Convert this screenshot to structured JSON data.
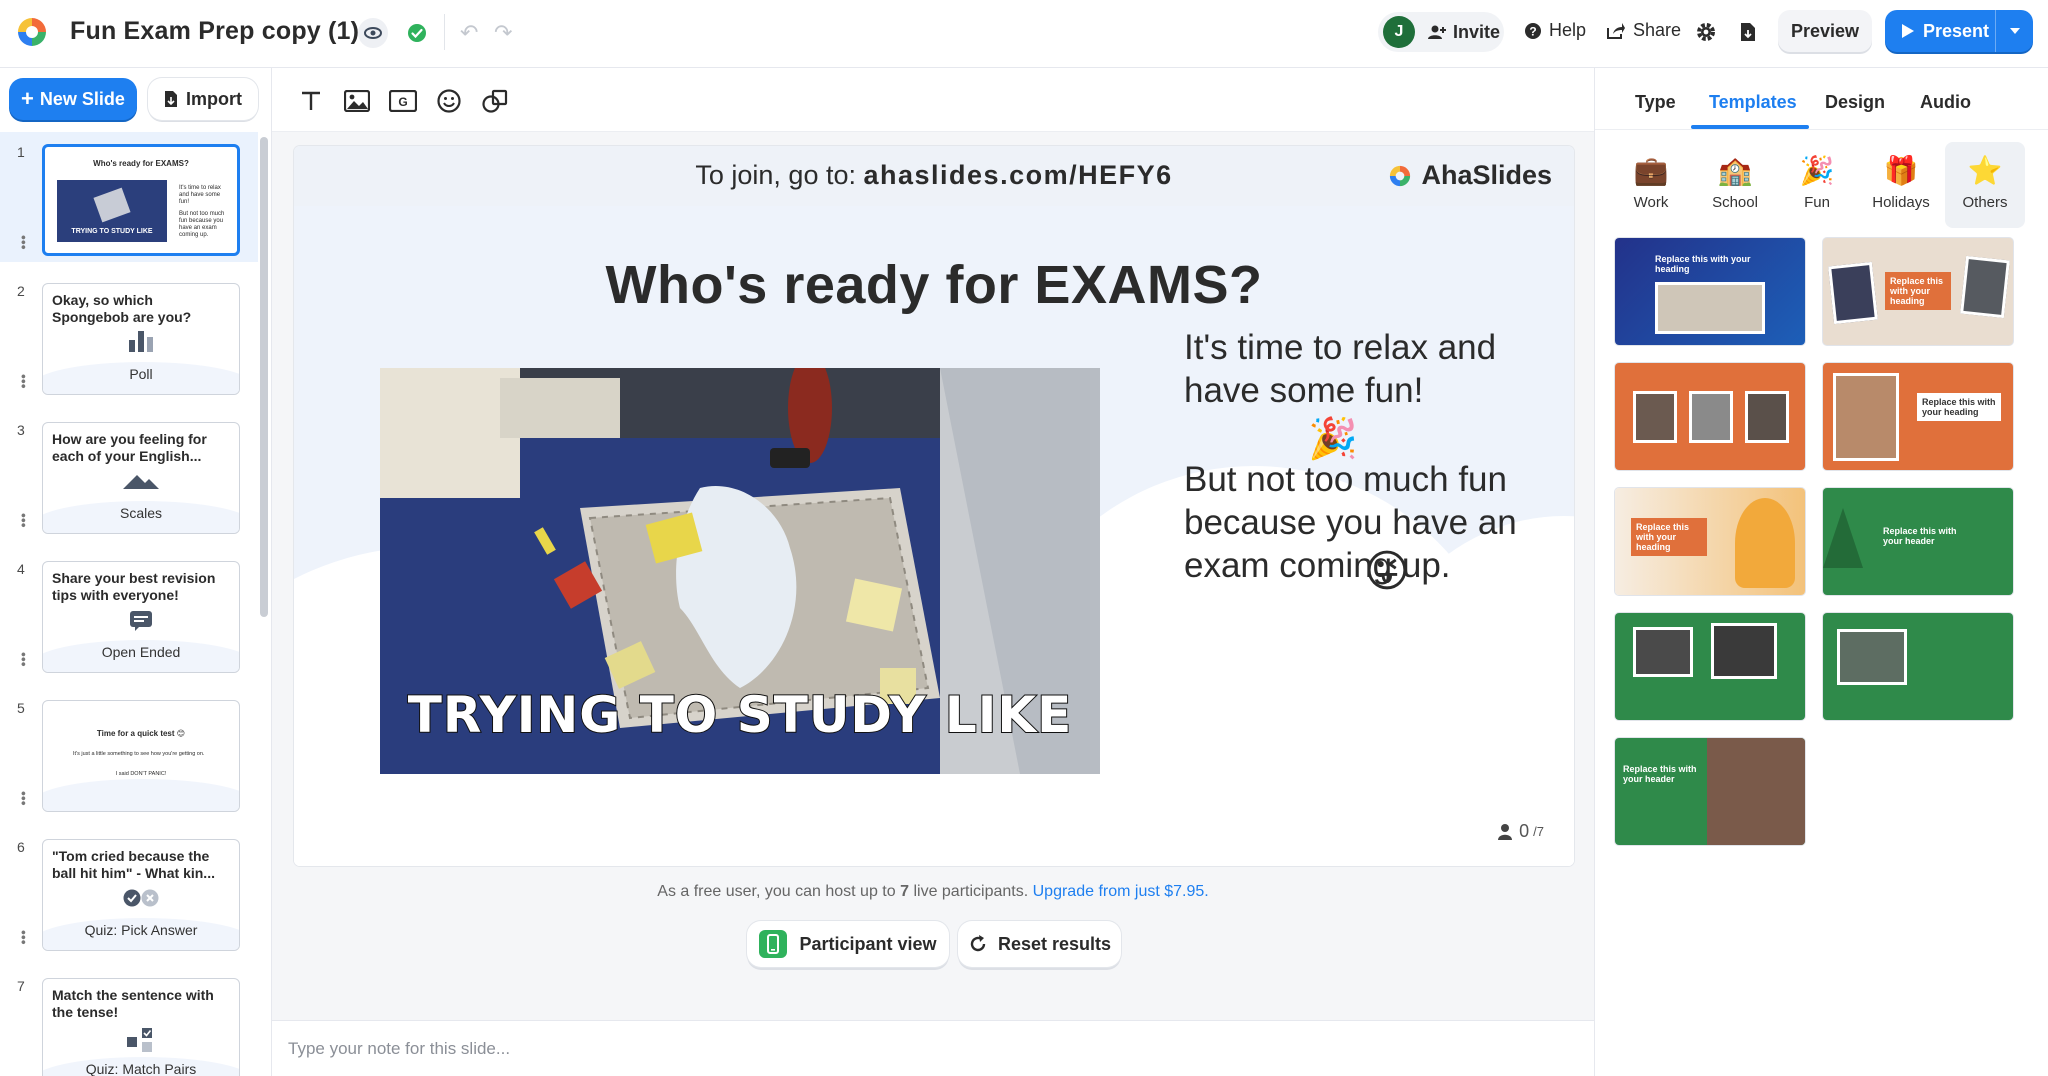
{
  "app": {
    "title": "Fun Exam Prep copy (1)"
  },
  "topbar": {
    "avatar_initial": "J",
    "invite_label": "Invite",
    "help_label": "Help",
    "share_label": "Share",
    "preview_label": "Preview",
    "present_label": "Present"
  },
  "left_panel": {
    "new_slide_label": "New Slide",
    "import_label": "Import"
  },
  "slides": [
    {
      "number": "1",
      "title": "Who's ready for EXAMS?",
      "type": ""
    },
    {
      "number": "2",
      "title": "Okay, so which Spongebob are you?",
      "type": "Poll"
    },
    {
      "number": "3",
      "title": "How are you feeling for each of your English...",
      "type": "Scales"
    },
    {
      "number": "4",
      "title": "Share your best revision tips with everyone!",
      "type": "Open Ended"
    },
    {
      "number": "5",
      "title": "Time for a quick test",
      "type": ""
    },
    {
      "number": "6",
      "title": "\"Tom cried because the ball hit him\" - What kin...",
      "type": "Quiz: Pick Answer"
    },
    {
      "number": "7",
      "title": "Match the sentence with the tense!",
      "type": "Quiz: Match Pairs"
    }
  ],
  "thumb1": {
    "line1": "It's time to relax and have some fun!",
    "line2": "But not too much fun because you have an exam coming up.",
    "gif_caption": "TRYING TO STUDY LIKE"
  },
  "thumb5": {
    "line1": "It's just a little something to see how you're getting on.",
    "line2": "I said DON'T PANIC!"
  },
  "slide": {
    "join_prefix": "To join, go to:",
    "join_url": "ahaslides.com/HEFY6",
    "brand": "AhaSlides",
    "heading": "Who's ready for EXAMS?",
    "gif_caption": "TRYING TO STUDY LIKE",
    "text_1": "It's time to relax and have some fun!",
    "text_2": "But not too much fun because you have an exam coming up.",
    "participants_count": "0",
    "participants_max": "/7"
  },
  "footer": {
    "free_note_prefix": "As a free user, you can host up to",
    "free_note_limit": "7",
    "free_note_suffix": "live participants.",
    "upgrade_link": "Upgrade from just $7.95.",
    "participant_view_label": "Participant view",
    "reset_results_label": "Reset results",
    "note_placeholder": "Type your note for this slide..."
  },
  "right_panel": {
    "tabs": [
      "Type",
      "Templates",
      "Design",
      "Audio"
    ],
    "active_tab": "Templates",
    "categories": [
      {
        "label": "Work",
        "icon": "briefcase-icon"
      },
      {
        "label": "School",
        "icon": "school-icon"
      },
      {
        "label": "Fun",
        "icon": "party-popper-icon"
      },
      {
        "label": "Holidays",
        "icon": "gift-icon"
      },
      {
        "label": "Others",
        "icon": "star-icon"
      }
    ],
    "templates": [
      {
        "heading": "Replace this with your heading"
      },
      {
        "heading": "Replace this with your heading"
      },
      {
        "heading": ""
      },
      {
        "heading": "Replace this with your heading"
      },
      {
        "heading": "Replace this with your heading"
      },
      {
        "heading": "Replace this with your header"
      },
      {
        "heading": ""
      },
      {
        "heading": ""
      },
      {
        "heading": "Replace this with your header"
      }
    ]
  },
  "colors": {
    "accent": "#1e7ff0",
    "text": "#2b2b2b",
    "slide_bg": "#eef3fb",
    "template_orange": "#e0703b",
    "template_green": "#2f8a4a",
    "template_navy": "#23328a"
  }
}
